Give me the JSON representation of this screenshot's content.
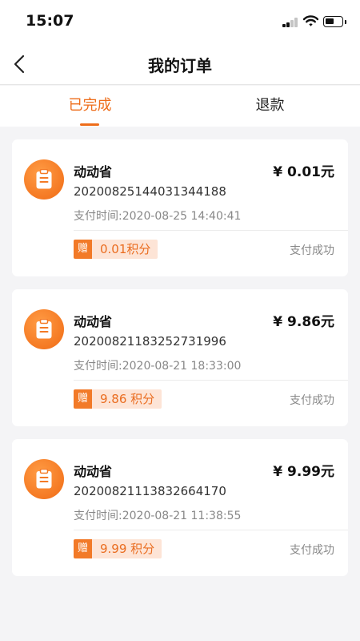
{
  "status_bar": {
    "time": "15:07"
  },
  "nav": {
    "title": "我的订单"
  },
  "tabs": [
    {
      "label": "已完成",
      "active": true
    },
    {
      "label": "退款",
      "active": false
    }
  ],
  "colors": {
    "accent": "#ee6d1a",
    "badge_bg": "#fde4d6",
    "background": "#f4f4f6"
  },
  "orders": [
    {
      "store": "动动省",
      "amount": "¥ 0.01元",
      "order_no": "20200825144031344188",
      "pay_time": "支付时间:2020-08-25 14:40:41",
      "gift_label": "赠",
      "points": "0.01积分",
      "status": "支付成功",
      "icon": "clipboard-icon"
    },
    {
      "store": "动动省",
      "amount": "¥ 9.86元",
      "order_no": "20200821183252731996",
      "pay_time": "支付时间:2020-08-21 18:33:00",
      "gift_label": "赠",
      "points": "9.86 积分",
      "status": "支付成功",
      "icon": "clipboard-icon"
    },
    {
      "store": "动动省",
      "amount": "¥ 9.99元",
      "order_no": "20200821113832664170",
      "pay_time": "支付时间:2020-08-21 11:38:55",
      "gift_label": "赠",
      "points": "9.99 积分",
      "status": "支付成功",
      "icon": "clipboard-icon"
    }
  ]
}
